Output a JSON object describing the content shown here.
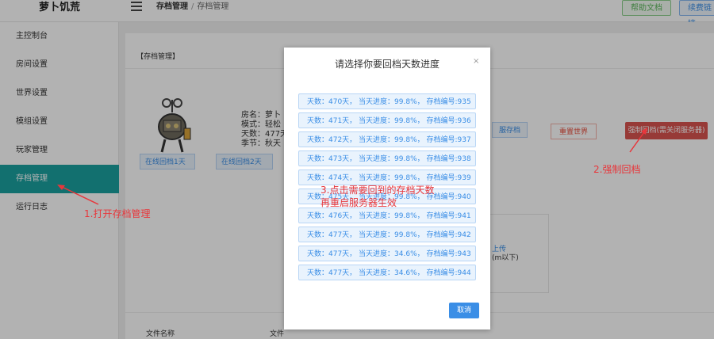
{
  "app": {
    "brand": "萝卜饥荒",
    "breadcrumb": {
      "current": "存档管理",
      "page": "存档管理"
    },
    "top_buttons": {
      "help": "帮助文档",
      "renew": "续费链接"
    }
  },
  "sidebar": {
    "items": [
      {
        "label": "主控制台"
      },
      {
        "label": "房间设置"
      },
      {
        "label": "世界设置"
      },
      {
        "label": "模组设置"
      },
      {
        "label": "玩家管理"
      },
      {
        "label": "存档管理"
      },
      {
        "label": "运行日志"
      }
    ],
    "active_index": 5
  },
  "main": {
    "panel_title": "【存档管理】",
    "info": [
      "房名：萝卜",
      "模式：轻松",
      "天数：477天",
      "季节：秋天"
    ],
    "rollback_buttons": [
      "在线回档1天",
      "在线回档2天"
    ],
    "right_buttons": {
      "blue": "服存档",
      "reset": "重置世界",
      "force": "强制回档(需关闭服务器)"
    },
    "upload": {
      "line1": "上传",
      "line2": "(m以下)"
    },
    "table_headers": [
      "文件名称",
      "文件"
    ]
  },
  "modal": {
    "title": "请选择你要回档天数进度",
    "close_symbol": "×",
    "items": [
      "天数：470天，  当天进度：99.8%，  存档编号:935",
      "天数：471天，  当天进度：99.8%，  存档编号:936",
      "天数：472天，  当天进度：99.8%，  存档编号:937",
      "天数：473天，  当天进度：99.8%，  存档编号:938",
      "天数：474天，  当天进度：99.8%，  存档编号:939",
      "天数：475天，  当天进度：99.8%，  存档编号:940",
      "天数：476天，  当天进度：99.8%，  存档编号:941",
      "天数：477天，  当天进度：99.8%，  存档编号:942",
      "天数：477天，  当天进度：34.6%，  存档编号:943",
      "天数：477天，  当天进度：34.6%，  存档编号:944"
    ],
    "cancel": "取消"
  },
  "annotations": {
    "step1": "1.打开存档管理",
    "step2": "2.强制回档",
    "step3_line1": "3.点击需要回到的存档天数",
    "step3_line2": "再重启服务器生效",
    "color": "#e8363b"
  },
  "colors": {
    "accent": "#1aa1a0",
    "link": "#3a8ee6",
    "danger": "#d9534f"
  }
}
